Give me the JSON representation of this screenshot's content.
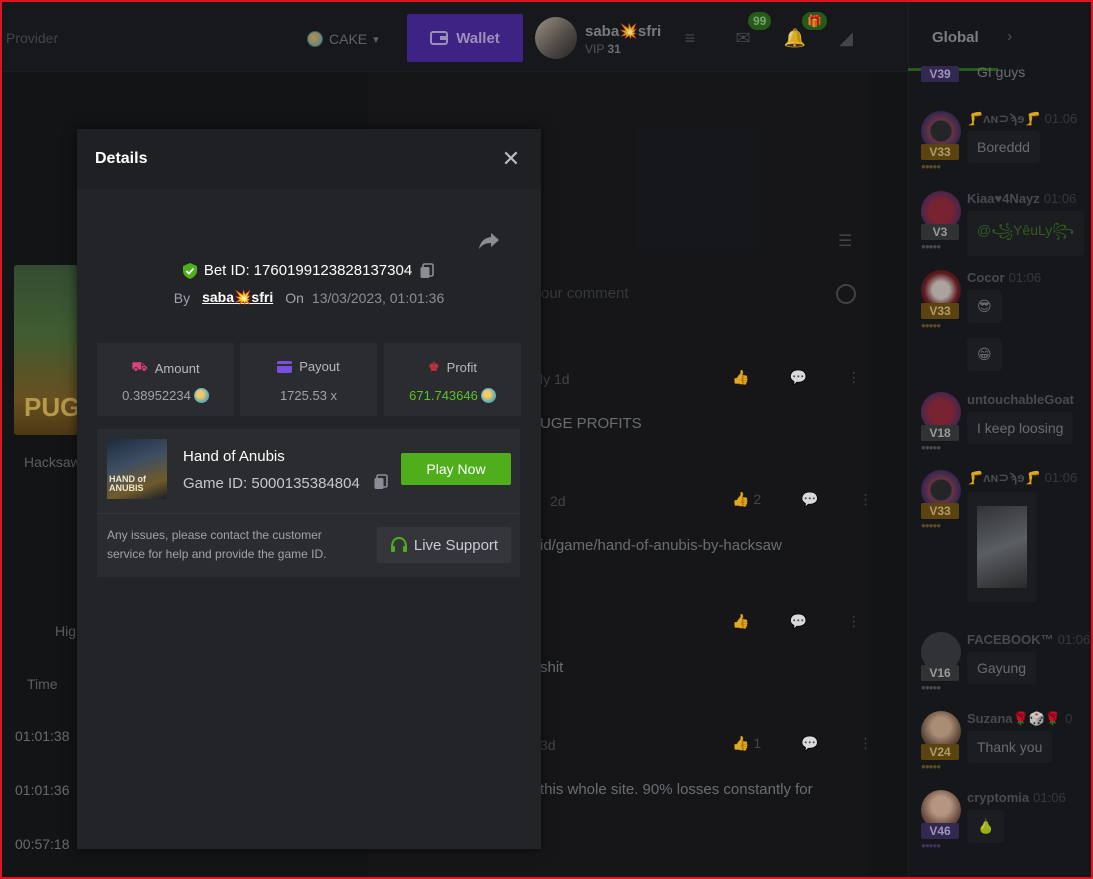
{
  "topbar": {
    "provider_label": "Provider",
    "currency": "CAKE",
    "wallet_label": "Wallet",
    "username": "saba💥sfri",
    "vip_prefix": "VIP",
    "vip_level": "31",
    "mail_count": "99",
    "gift_badge": "🎁"
  },
  "left": {
    "thumb_text": "PUG",
    "provider": "Hacksaw",
    "tab_label": "Hig",
    "time_header": "Time",
    "times": [
      "01:01:38",
      "01:01:36",
      "00:57:18"
    ]
  },
  "comments": {
    "input_placeholder": "our comment",
    "items": [
      {
        "meta": "ly  1d",
        "text": "UGE PROFITS",
        "likes": ""
      },
      {
        "meta": "2d",
        "text": "id/game/hand-of-anubis-by-hacksaw",
        "likes": "2"
      },
      {
        "meta": "",
        "text": "shit",
        "likes": ""
      },
      {
        "meta": "3d",
        "text": "this whole site. 90% losses constantly for",
        "likes": "1"
      }
    ]
  },
  "chat": {
    "tab": "Global",
    "items": [
      {
        "name": "",
        "time": "",
        "msg": "GI guys",
        "vip": "V39",
        "style": "purple"
      },
      {
        "name": "🦵ʌɴ⊃ϡɘ🦵",
        "time": "01:06",
        "msg": "Boreddd",
        "vip": "V33",
        "style": "gold"
      },
      {
        "name": "Kiaa♥4Nayz",
        "time": "01:06",
        "msg": "@꧁YêuLy꧂",
        "vip": "V3",
        "style": "gray"
      },
      {
        "name": "Cocor",
        "time": "01:06",
        "msg": "😎",
        "vip": "V33",
        "style": "gold"
      },
      {
        "name": "",
        "time": "",
        "msg": "😁",
        "vip": "",
        "style": ""
      },
      {
        "name": "untouchableGoat",
        "time": "",
        "msg": "I keep loosing",
        "vip": "V18",
        "style": "gray"
      },
      {
        "name": "🦵ʌɴ⊃ϡɘ🦵",
        "time": "01:06",
        "msg": "",
        "vip": "V33",
        "style": "gold"
      },
      {
        "name": "FACEBOOK™",
        "time": "01:06",
        "msg": "Gayung",
        "vip": "V16",
        "style": "gray"
      },
      {
        "name": "Suzana🌹🎲🌹",
        "time": "0",
        "msg": "Thank you",
        "vip": "V24",
        "style": "gold"
      },
      {
        "name": "cryptomia",
        "time": "01:06",
        "msg": "🍐",
        "vip": "V46",
        "style": "purple"
      }
    ]
  },
  "modal": {
    "title": "Details",
    "bet_label": "Bet ID:",
    "bet_id": "1760199123828137304",
    "by_label": "By",
    "by_user": "saba💥sfri",
    "on_label": "On",
    "date": "13/03/2023, 01:01:36",
    "stats": {
      "amount_label": "Amount",
      "amount_value": "0.38952234",
      "payout_label": "Payout",
      "payout_value": "1725.53 x",
      "profit_label": "Profit",
      "profit_value": "671.743646"
    },
    "game": {
      "name": "Hand of Anubis",
      "id_label": "Game ID:",
      "id": "5000135384804",
      "thumb_text": "HAND of ANUBIS",
      "play_label": "Play Now"
    },
    "support": {
      "text": "Any issues, please contact the customer service for help and provide the game ID.",
      "button": "Live Support"
    }
  },
  "colors": {
    "accent_green": "#4fae1c",
    "profit_green": "#59c327",
    "wallet_purple": "#4b2a9c",
    "frame_red": "#e0141e"
  }
}
